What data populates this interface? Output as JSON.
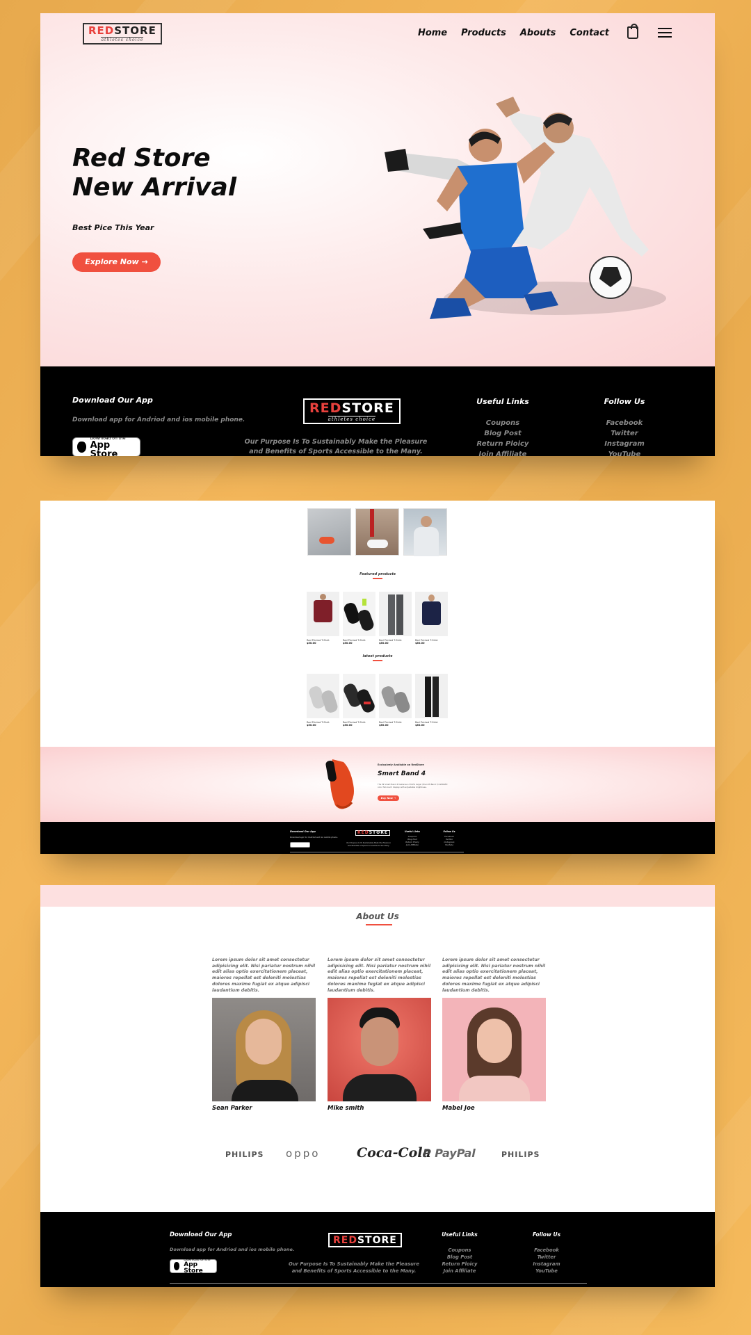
{
  "colors": {
    "accent": "#f0503f",
    "background": "#edae52",
    "hero_bg": "#fde4e4",
    "footer_bg": "#000000"
  },
  "header": {
    "logo": {
      "red": "RED",
      "dark": "STORE",
      "tagline": "athletes choice"
    },
    "nav": [
      "Home",
      "Products",
      "Abouts",
      "Contact"
    ],
    "icons": [
      "shopping-bag-icon",
      "hamburger-menu-icon"
    ]
  },
  "hero": {
    "title_line1": "Red Store",
    "title_line2": "New Arrival",
    "subtitle": "Best Pice This Year",
    "cta": "Explore Now →",
    "image": "soccer-players-image"
  },
  "footer": {
    "download_title": "Download Our App",
    "download_text": "Download app for Andriod and ios mobile phone.",
    "app_store_small": "Download on the",
    "app_store_big": "App Store",
    "purpose_line1": "Our Purpose Is To Sustainably Make the Pleasure",
    "purpose_line2": "and Benefits of Sports Accessible to the Many.",
    "useful_title": "Useful Links",
    "useful_links": [
      "Coupons",
      "Blog Post",
      "Return Ploicy",
      "Join Affiliate"
    ],
    "follow_title": "Follow Us",
    "follow_links": [
      "Facebook",
      "Twitter",
      "Instagram",
      "YouTube"
    ]
  },
  "products_page": {
    "categories": [
      "category-1",
      "category-2",
      "category-3"
    ],
    "featured_title": "Featured products",
    "latest_title": "latest products",
    "product_name": "Red Printed T-Shirt",
    "product_price": "$50.00",
    "offer_label": "Exclusively Available on RedStore",
    "offer_title": "Smart Band 4",
    "offer_text": "The Mi Smart Band 4 features a 39.9% larger (than Mi Band 3) AMOLED color full-touch display with adjustable brightness.",
    "offer_button": "Buy Now →"
  },
  "about": {
    "title": "About Us",
    "paragraph": "Lorem ipsum dolor sit amet consectetur adipisicing elit. Nisi pariatur nostrum nihil edit alias optio exercitationem placeat, maiores repellat est deleniti molestias dolores maxime fugiat ex atque adipisci laudantium debitis.",
    "people": [
      "Sean Parker",
      "Mike smith",
      "Mabel Joe"
    ],
    "brands": [
      "PHILIPS",
      "oppo",
      "Coca-Cola",
      "PayPal",
      "PHILIPS"
    ]
  }
}
